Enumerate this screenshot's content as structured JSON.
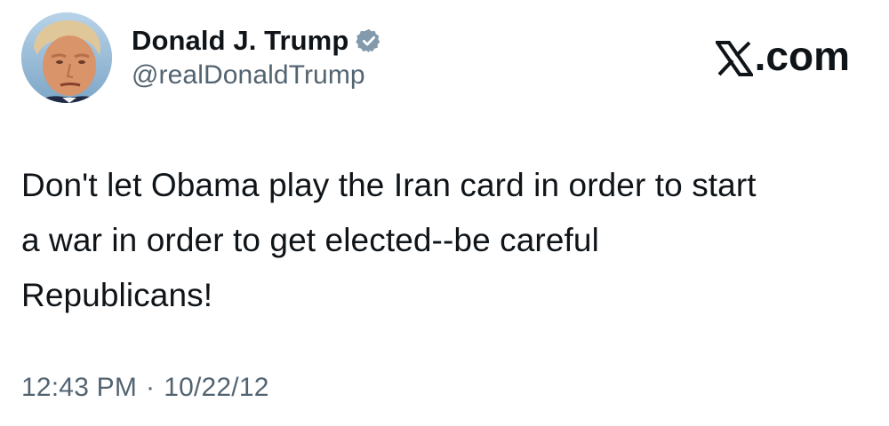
{
  "author": {
    "display_name": "Donald J. Trump",
    "handle": "@realDonaldTrump",
    "verified": true,
    "avatar": "profile-photo"
  },
  "brand": {
    "label": ".com",
    "icon": "x-logo-icon"
  },
  "tweet": {
    "text": "Don't let Obama play the Iran card in order to start\na war in order to get elected--be careful\nRepublicans!"
  },
  "meta": {
    "time": "12:43 PM",
    "separator": "·",
    "date": "10/22/12"
  },
  "colors": {
    "text": "#0f1419",
    "secondary": "#536471",
    "verified_badge": "#829aab"
  }
}
